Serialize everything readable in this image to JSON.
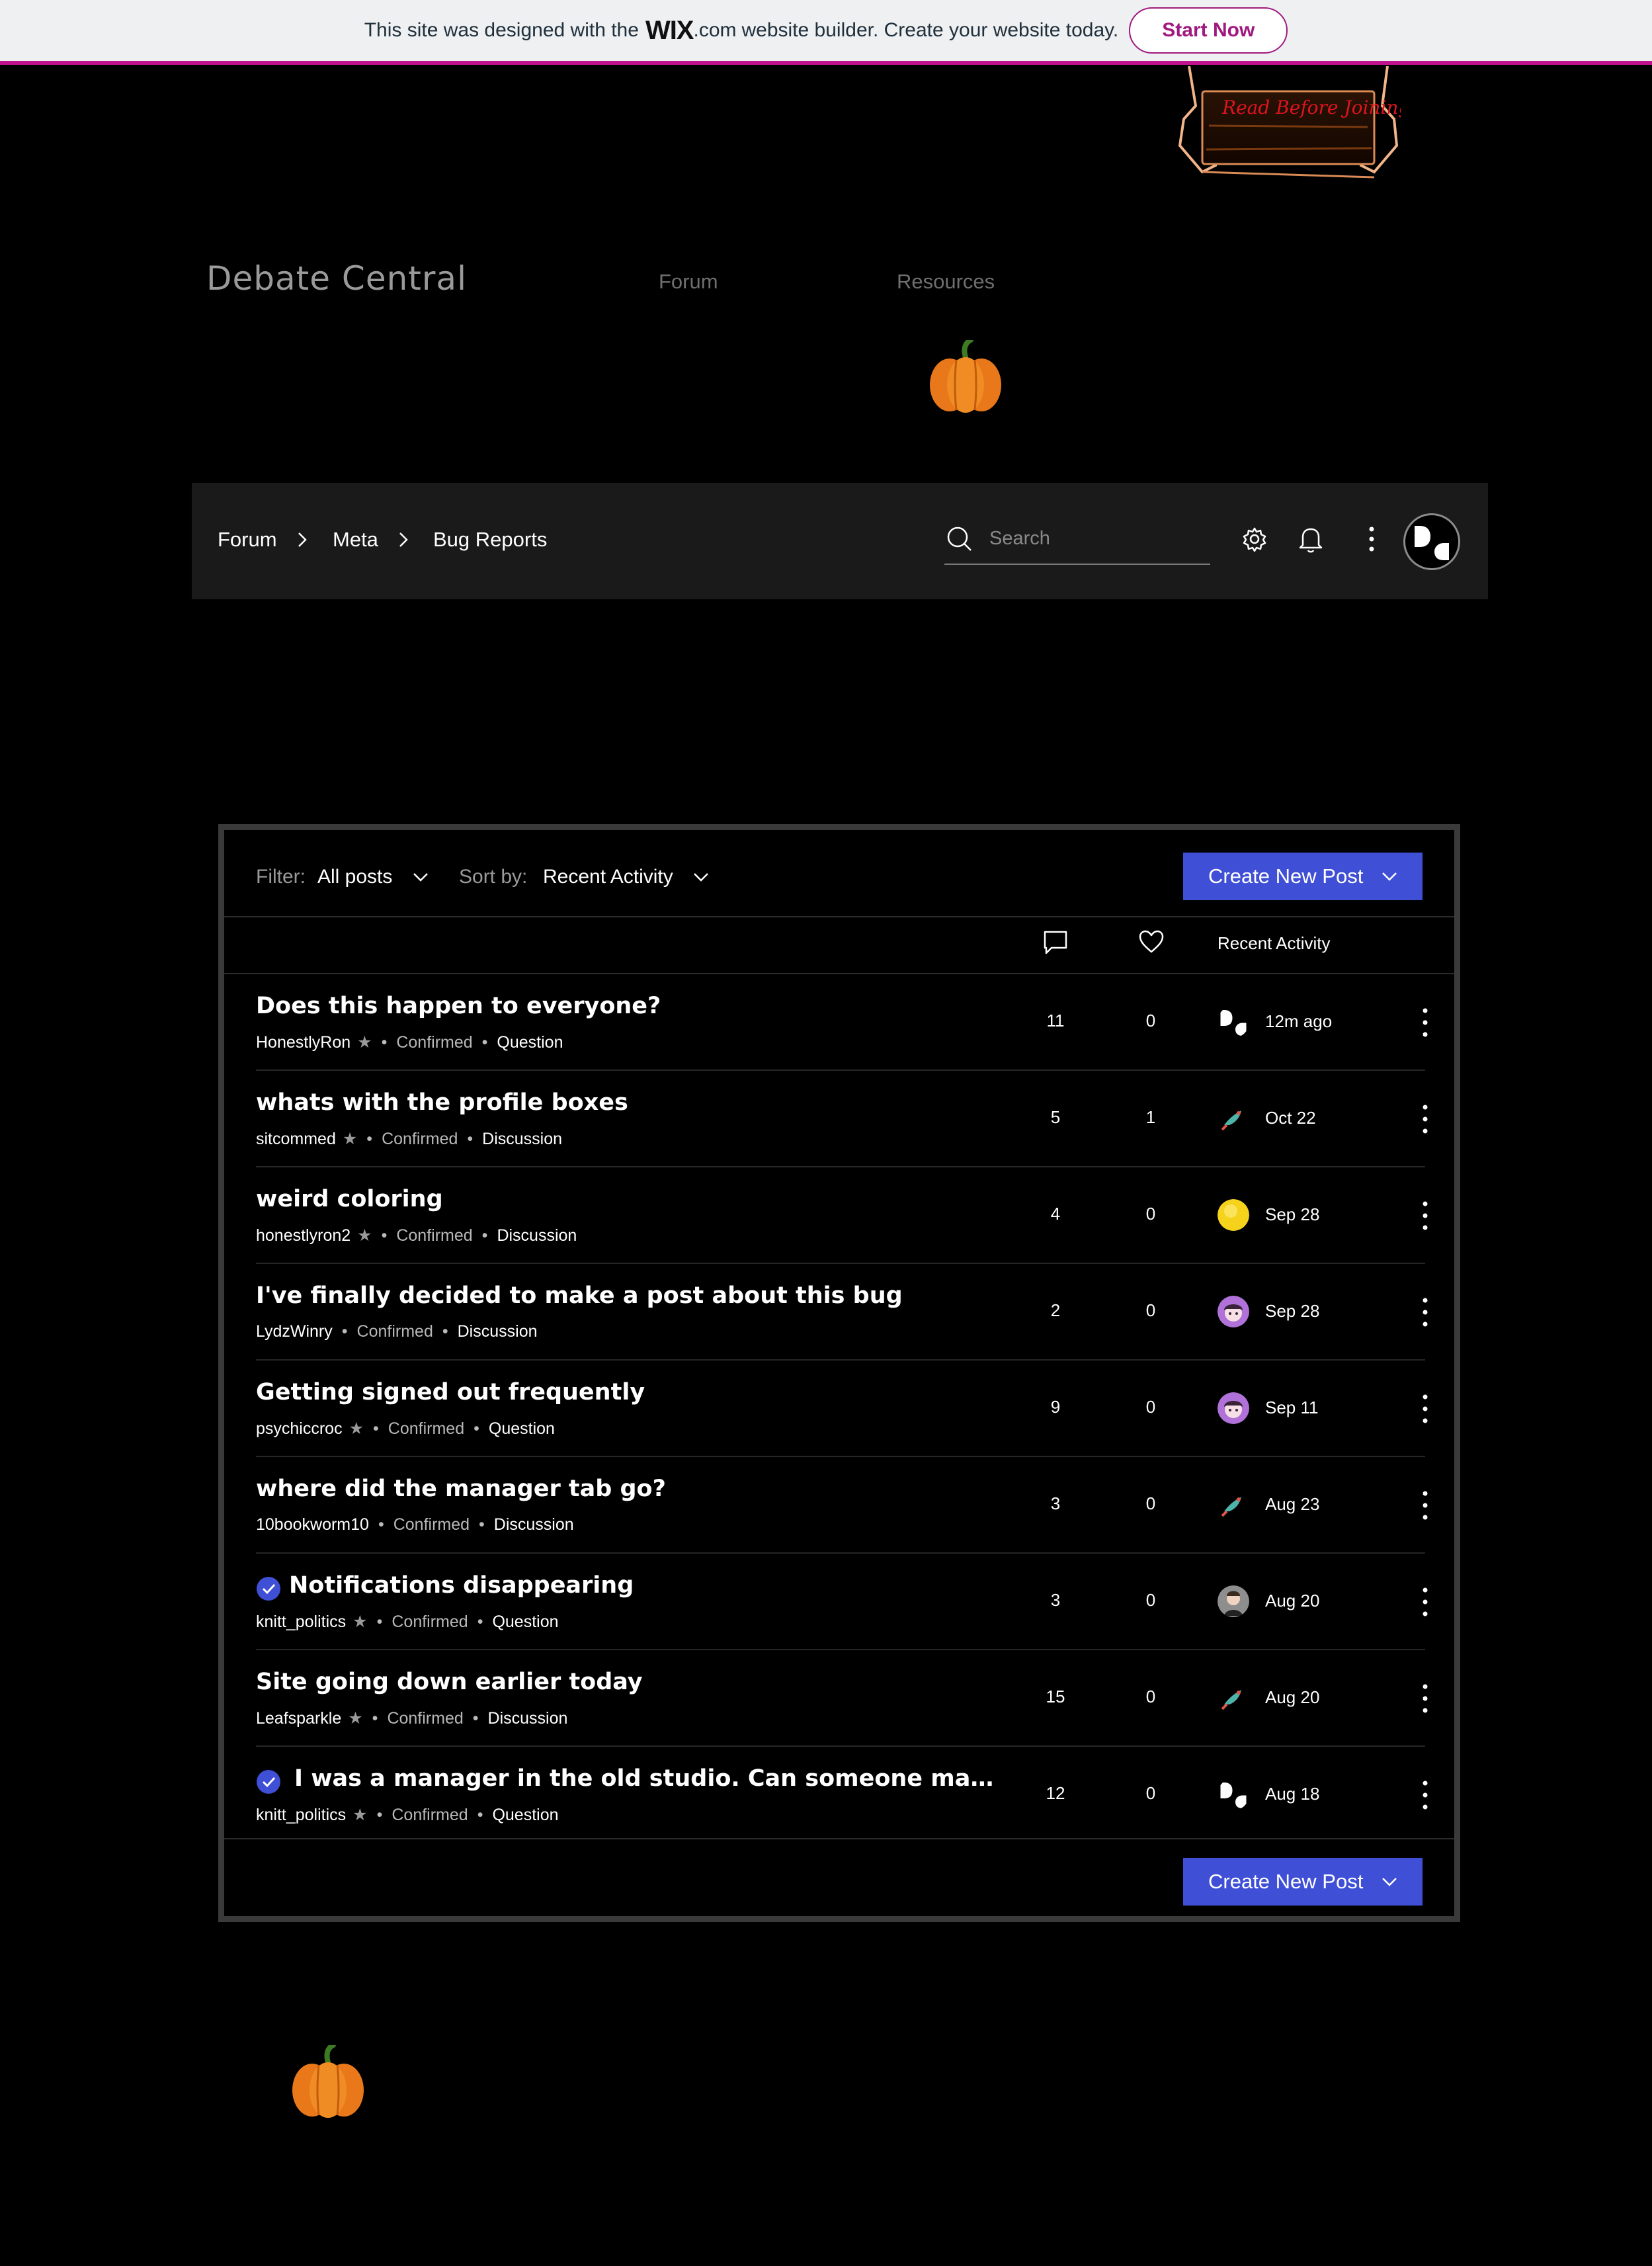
{
  "wix_banner": {
    "message_before": "This site was designed with the",
    "logo": "WIX",
    "message_after_logo": ".com",
    "message_after": "website builder. Create your website today.",
    "cta": "Start Now",
    "accent": "#c0148f"
  },
  "header": {
    "site_title": "Debate Central",
    "nav": [
      "Forum",
      "Resources"
    ],
    "signboard_text": "Read Before Joining",
    "decoration_icon": "pumpkin-icon"
  },
  "forum_bar": {
    "breadcrumbs": [
      "Forum",
      "Meta",
      "Bug Reports"
    ],
    "search_placeholder": "Search",
    "icons": [
      "search-icon",
      "gear-icon",
      "bell-icon",
      "more-icon",
      "avatar"
    ]
  },
  "controls": {
    "filter_label": "Filter:",
    "filter_value": "All posts",
    "sort_label": "Sort by:",
    "sort_value": "Recent Activity",
    "create_button": "Create New Post",
    "accent": "#3f4fd6"
  },
  "table_header": {
    "comments_icon": "comment-icon",
    "likes_icon": "heart-icon",
    "activity": "Recent Activity"
  },
  "posts": [
    {
      "title": "Does this happen to everyone?",
      "author": "HonestlyRon",
      "star": true,
      "status": "Confirmed",
      "type": "Question",
      "comments": "11",
      "likes": "0",
      "activity": "12m ago",
      "avatar": "mono",
      "verified": false
    },
    {
      "title": "whats with the profile boxes",
      "author": "sitcommed",
      "star": true,
      "status": "Confirmed",
      "type": "Discussion",
      "comments": "5",
      "likes": "1",
      "activity": "Oct 22",
      "avatar": "bird",
      "verified": false
    },
    {
      "title": "weird coloring",
      "author": "honestlyron2",
      "star": true,
      "status": "Confirmed",
      "type": "Discussion",
      "comments": "4",
      "likes": "0",
      "activity": "Sep 28",
      "avatar": "yellow",
      "verified": false
    },
    {
      "title": "I've finally decided to make a post about this bug",
      "author": "LydzWinry",
      "star": false,
      "status": "Confirmed",
      "type": "Discussion",
      "comments": "2",
      "likes": "0",
      "activity": "Sep 28",
      "avatar": "purple",
      "verified": false
    },
    {
      "title": "Getting signed out frequently",
      "author": "psychiccroc",
      "star": true,
      "status": "Confirmed",
      "type": "Question",
      "comments": "9",
      "likes": "0",
      "activity": "Sep 11",
      "avatar": "purple",
      "verified": false
    },
    {
      "title": "where did the manager tab go?",
      "author": "10bookworm10",
      "star": false,
      "status": "Confirmed",
      "type": "Discussion",
      "comments": "3",
      "likes": "0",
      "activity": "Aug 23",
      "avatar": "bird",
      "verified": false
    },
    {
      "title": "Notifications disappearing",
      "author": "knitt_politics",
      "star": true,
      "status": "Confirmed",
      "type": "Question",
      "comments": "3",
      "likes": "0",
      "activity": "Aug 20",
      "avatar": "person",
      "verified": true
    },
    {
      "title": "Site going down earlier today",
      "author": "Leafsparkle",
      "star": true,
      "status": "Confirmed",
      "type": "Discussion",
      "comments": "15",
      "likes": "0",
      "activity": "Aug 20",
      "avatar": "bird",
      "verified": false
    },
    {
      "title": "I was a manager in the old studio. Can someone make me a ...",
      "author": "knitt_politics",
      "star": true,
      "status": "Confirmed",
      "type": "Question",
      "comments": "12",
      "likes": "0",
      "activity": "Aug 18",
      "avatar": "mono",
      "verified": true
    }
  ]
}
